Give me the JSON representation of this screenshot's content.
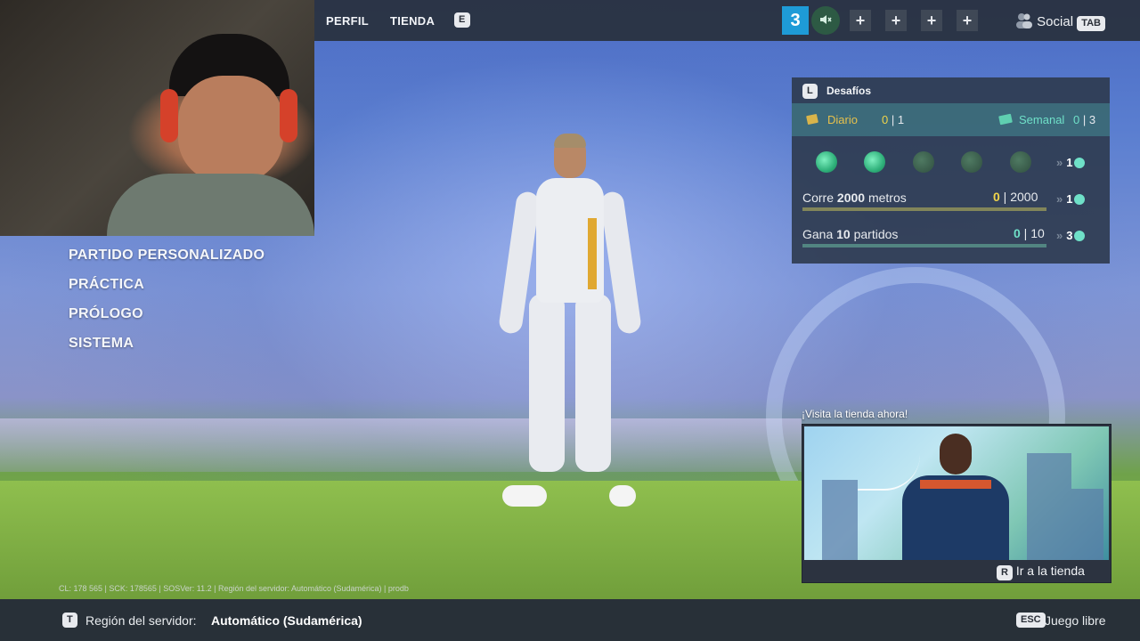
{
  "topbar": {
    "nav": [
      "PERFIL",
      "TIENDA"
    ],
    "nav_key": "E",
    "party_count": "3",
    "mute_icon": "speaker-muted-icon",
    "slot_symbol": "+",
    "social_label": "Social",
    "social_key": "TAB"
  },
  "menu": {
    "items": [
      "PARTIDO PERSONALIZADO",
      "PRÁCTICA",
      "PRÓLOGO",
      "SISTEMA"
    ]
  },
  "challenges": {
    "key": "L",
    "title": "Desafíos",
    "daily": {
      "label": "Diario",
      "done": "0",
      "total": "1"
    },
    "weekly": {
      "label": "Semanal",
      "done": "0",
      "total": "3"
    },
    "dots_reward": "1",
    "rows": [
      {
        "pre": "Corre ",
        "bold": "2000",
        "post": " metros",
        "done": "0",
        "total": "2000",
        "reward": "1",
        "progress": 0
      },
      {
        "pre": "Gana ",
        "bold": "10",
        "post": " partidos",
        "done": "0",
        "total": "10",
        "reward": "3",
        "progress": 0
      }
    ],
    "dots_filled": 2,
    "dots_total": 5
  },
  "shop": {
    "title": "¡Visita la tienda ahora!",
    "cta_key": "R",
    "cta_label": "Ir a la tienda"
  },
  "debug_text": "CL: 178 565 | SCK: 178565 | SOSVer: 11.2 | Región del servidor: Automático (Sudamérica) | prodb",
  "bottombar": {
    "region_key": "T",
    "region_label": "Región del servidor:",
    "region_value": "Automático (Sudamérica)",
    "free_key": "ESC",
    "free_label": "Juego libre"
  },
  "colors": {
    "accent_blue": "#1e9bd7",
    "daily_yellow": "#e6c04c",
    "weekly_teal": "#6fe0c8"
  }
}
